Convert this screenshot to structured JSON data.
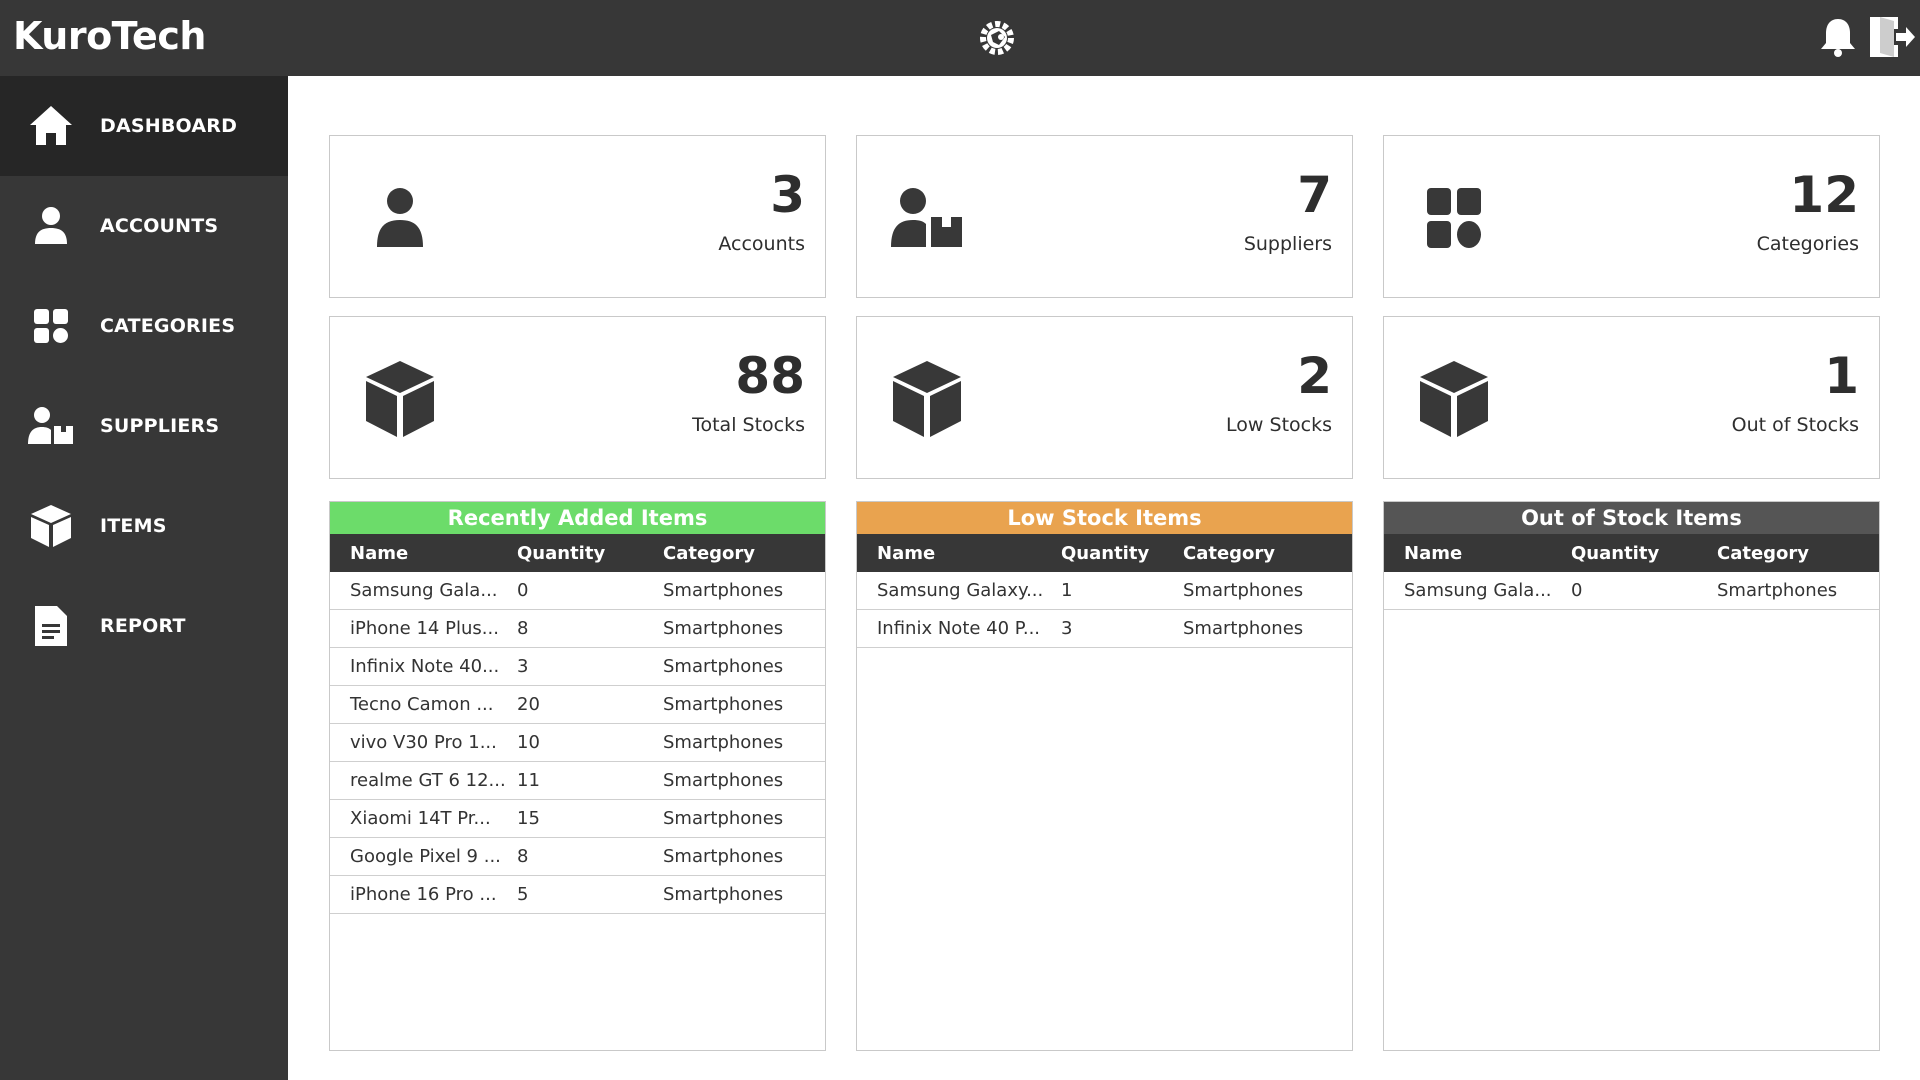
{
  "app": {
    "title": "KuroTech"
  },
  "colors": {
    "topbar": "#373737",
    "sidebar": "#373737",
    "active": "#262626",
    "green": "#6cdc6a",
    "orange": "#e9a34f",
    "gray": "#555555"
  },
  "sidebar": {
    "items": [
      {
        "label": "DASHBOARD",
        "icon": "home-icon"
      },
      {
        "label": "ACCOUNTS",
        "icon": "user-icon"
      },
      {
        "label": "CATEGORIES",
        "icon": "grid-icon"
      },
      {
        "label": "SUPPLIERS",
        "icon": "supplier-icon"
      },
      {
        "label": "ITEMS",
        "icon": "box-icon"
      },
      {
        "label": "REPORT",
        "icon": "document-icon"
      }
    ]
  },
  "stats": {
    "accounts": {
      "value": "3",
      "label": "Accounts"
    },
    "suppliers": {
      "value": "7",
      "label": "Suppliers"
    },
    "categories": {
      "value": "12",
      "label": "Categories"
    },
    "total_stocks": {
      "value": "88",
      "label": "Total Stocks"
    },
    "low_stocks": {
      "value": "2",
      "label": "Low Stocks"
    },
    "out_of_stocks": {
      "value": "1",
      "label": "Out of Stocks"
    }
  },
  "columns": {
    "name": "Name",
    "quantity": "Quantity",
    "category": "Category"
  },
  "recent": {
    "title": "Recently Added Items",
    "rows": [
      {
        "name": "Samsung Gala...",
        "qty": "0",
        "cat": "Smartphones"
      },
      {
        "name": "iPhone 14 Plus...",
        "qty": "8",
        "cat": "Smartphones"
      },
      {
        "name": "Infinix Note 40...",
        "qty": "3",
        "cat": "Smartphones"
      },
      {
        "name": "Tecno Camon ...",
        "qty": "20",
        "cat": "Smartphones"
      },
      {
        "name": "vivo V30 Pro 1...",
        "qty": "10",
        "cat": "Smartphones"
      },
      {
        "name": "realme GT 6 12...",
        "qty": "11",
        "cat": "Smartphones"
      },
      {
        "name": "Xiaomi 14T Pr...",
        "qty": "15",
        "cat": "Smartphones"
      },
      {
        "name": "Google Pixel 9 ...",
        "qty": "8",
        "cat": "Smartphones"
      },
      {
        "name": "iPhone 16 Pro ...",
        "qty": "5",
        "cat": "Smartphones"
      }
    ]
  },
  "low": {
    "title": "Low Stock Items",
    "rows": [
      {
        "name": "Samsung Galaxy...",
        "qty": "1",
        "cat": "Smartphones"
      },
      {
        "name": "Infinix Note 40 P...",
        "qty": "3",
        "cat": "Smartphones"
      }
    ]
  },
  "out": {
    "title": "Out of Stock Items",
    "rows": [
      {
        "name": "Samsung Gala...",
        "qty": "0",
        "cat": "Smartphones"
      }
    ]
  }
}
